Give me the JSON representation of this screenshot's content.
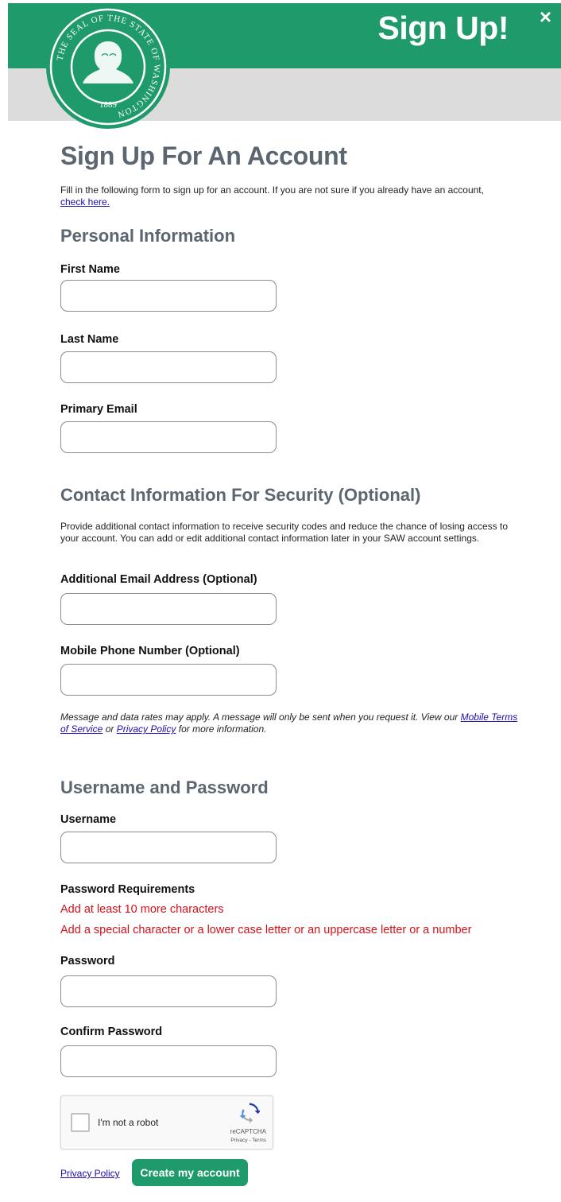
{
  "header": {
    "title": "Sign Up!",
    "close_symbol": "×",
    "seal_text": "THE SEAL OF THE STATE OF WASHINGTON",
    "seal_year": "1889",
    "accent_color": "#1f9a6a"
  },
  "page_title": "Sign Up For An Account",
  "intro": {
    "text": "Fill in the following form to sign up for an account. If you are not sure if you already have an account,",
    "link": "check here."
  },
  "personal": {
    "heading": "Personal Information",
    "first_name_label": "First Name",
    "last_name_label": "Last Name",
    "primary_email_label": "Primary Email"
  },
  "contact": {
    "heading": "Contact Information For Security (Optional)",
    "description": "Provide additional contact information to receive security codes and reduce the chance of losing access to your account. You can add or edit additional contact information later in your SAW account settings.",
    "additional_email_label": "Additional Email Address (Optional)",
    "mobile_phone_label": "Mobile Phone Number (Optional)",
    "note_text": "Message and data rates may apply. A message will only be sent when you request it. View our",
    "note_link_terms": "Mobile Terms of Service",
    "note_or": "or",
    "note_link_privacy": "Privacy Policy",
    "note_end": "for more information."
  },
  "credentials": {
    "heading": "Username and Password",
    "username_label": "Username",
    "requirements_label": "Password Requirements",
    "requirements": [
      "Add at least 10 more characters",
      "Add a special character or a lower case letter or an uppercase letter or a number"
    ],
    "password_label": "Password",
    "confirm_password_label": "Confirm Password"
  },
  "captcha": {
    "label": "I'm not a robot",
    "brand": "reCAPTCHA",
    "links": "Privacy - Terms"
  },
  "footer": {
    "privacy_link": "Privacy Policy",
    "submit_label": "Create my account"
  }
}
